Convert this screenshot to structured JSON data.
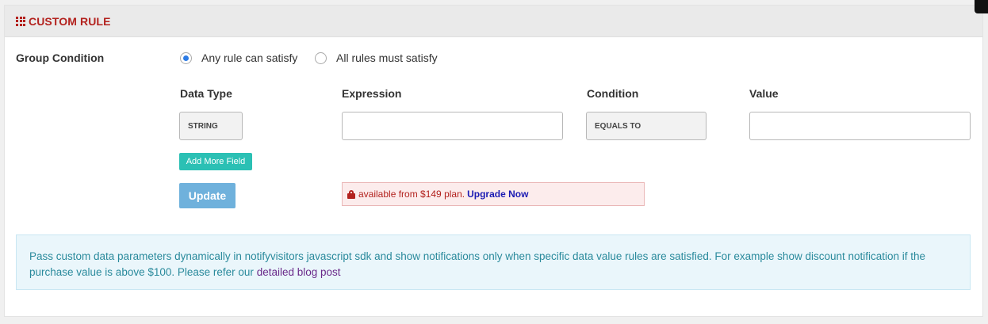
{
  "header": {
    "title": "CUSTOM RULE",
    "icon": "grid-icon"
  },
  "group_condition": {
    "label": "Group Condition",
    "options": [
      {
        "label": "Any rule can satisfy",
        "selected": true
      },
      {
        "label": "All rules must satisfy",
        "selected": false
      }
    ]
  },
  "columns": {
    "data_type": "Data Type",
    "expression": "Expression",
    "condition": "Condition",
    "value": "Value"
  },
  "row": {
    "data_type_value": "STRING",
    "expression_value": "",
    "condition_value": "EQUALS TO",
    "value_value": ""
  },
  "buttons": {
    "add_field": "Add More Field",
    "update": "Update"
  },
  "upgrade": {
    "text": "available from $149 plan.",
    "link": "Upgrade Now"
  },
  "info": {
    "text": "Pass custom data parameters dynamically in notifyvisitors javascript sdk and show notifications only when specific data value rules are satisfied. For example show discount notification if the purchase value is above $100. Please refer our ",
    "link": "detailed blog post"
  },
  "colors": {
    "title": "#b3221e",
    "accent": "#2c7be5",
    "add_button": "#2bc0b4",
    "update_button": "#6fb1dc",
    "info_text": "#2a8a9c"
  }
}
